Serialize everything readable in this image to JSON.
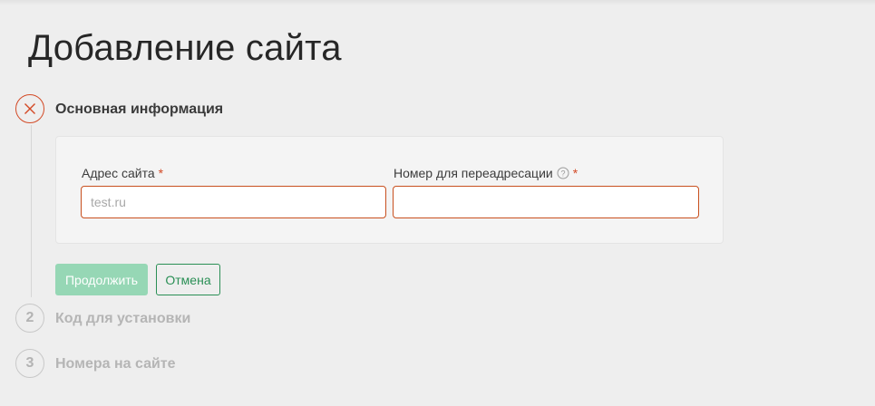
{
  "page": {
    "title": "Добавление сайта"
  },
  "steps": [
    {
      "number": "",
      "title": "Основная информация",
      "state": "error"
    },
    {
      "number": "2",
      "title": "Код для установки",
      "state": "pending"
    },
    {
      "number": "3",
      "title": "Номера на сайте",
      "state": "pending"
    }
  ],
  "form": {
    "site_address": {
      "label": "Адрес сайта",
      "required_mark": "*",
      "placeholder": "test.ru",
      "value": ""
    },
    "redirect_number": {
      "label": "Номер для переадресации",
      "required_mark": "*",
      "placeholder": "",
      "value": "",
      "help_icon": "question-circle-icon"
    }
  },
  "buttons": {
    "continue_label": "Продолжить",
    "cancel_label": "Отмена"
  },
  "colors": {
    "error": "#d34a26",
    "primary_disabled": "#96d7b5",
    "accent_green": "#2a8f55",
    "background": "#eeeeee"
  }
}
